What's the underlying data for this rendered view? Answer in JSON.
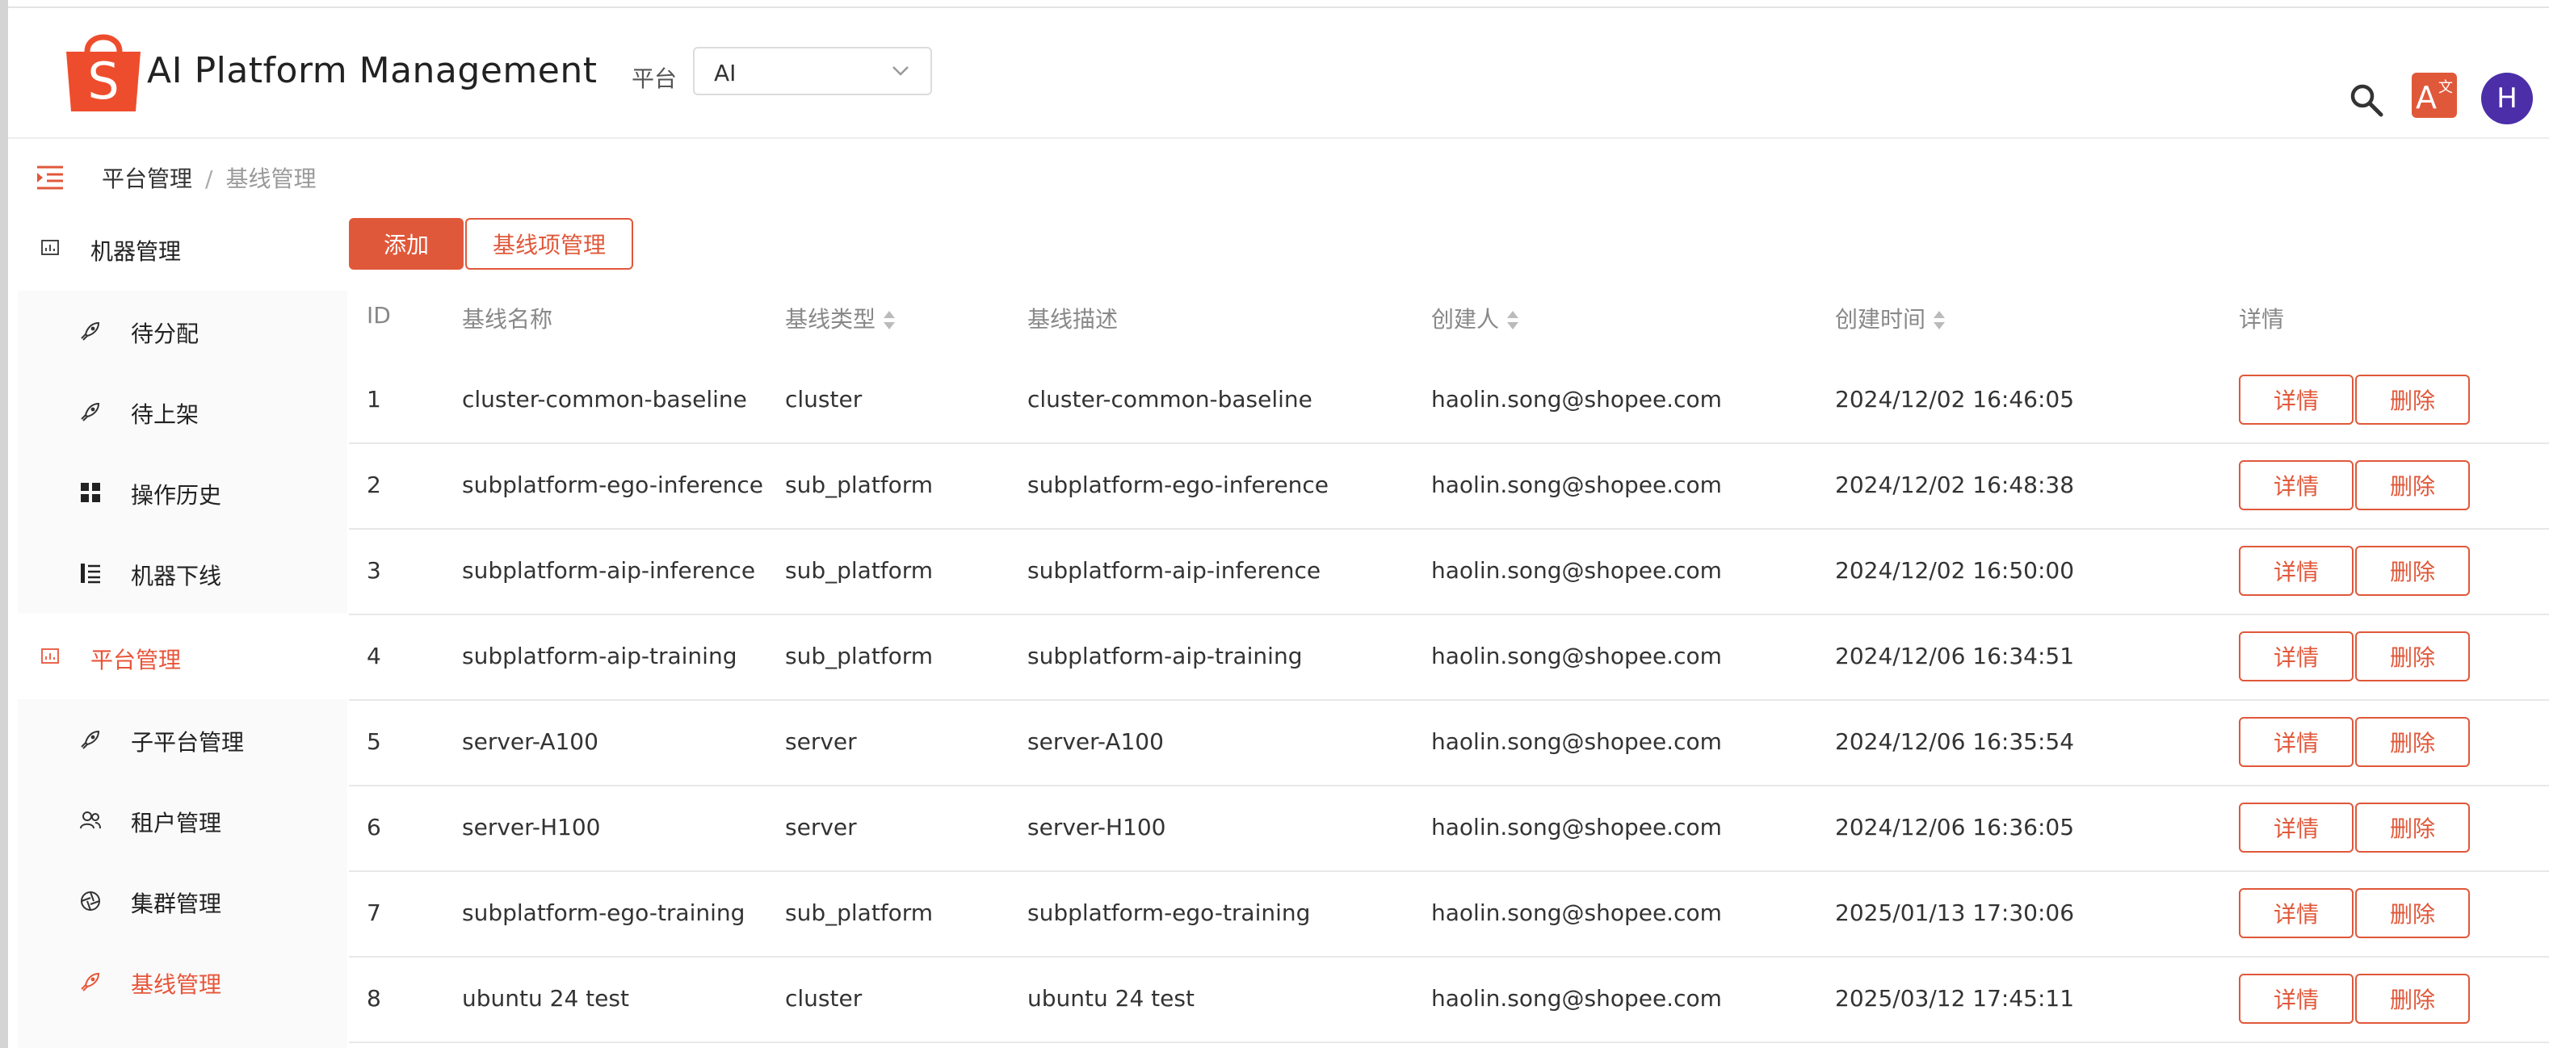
{
  "header": {
    "title": "AI Platform Management",
    "platform_label": "平台",
    "platform_value": "AI",
    "avatar_initial": "H"
  },
  "breadcrumb": {
    "items": [
      "平台管理",
      "基线管理"
    ],
    "separator": "/"
  },
  "sidebar": {
    "groups": [
      {
        "label": "机器管理",
        "items": [
          {
            "label": "待分配",
            "icon": "rocket-icon"
          },
          {
            "label": "待上架",
            "icon": "rocket-icon"
          },
          {
            "label": "操作历史",
            "icon": "grid-icon"
          },
          {
            "label": "机器下线",
            "icon": "list-icon"
          }
        ]
      },
      {
        "label": "平台管理",
        "items": [
          {
            "label": "子平台管理",
            "icon": "rocket-icon"
          },
          {
            "label": "租户管理",
            "icon": "users-icon"
          },
          {
            "label": "集群管理",
            "icon": "aperture-icon"
          },
          {
            "label": "基线管理",
            "icon": "rocket-icon"
          }
        ]
      }
    ]
  },
  "toolbar": {
    "add_label": "添加",
    "manage_label": "基线项管理"
  },
  "table": {
    "columns": [
      "ID",
      "基线名称",
      "基线类型",
      "基线描述",
      "创建人",
      "创建时间",
      "详情"
    ],
    "rows": [
      {
        "id": "1",
        "name": "cluster-common-baseline",
        "type": "cluster",
        "desc": "cluster-common-baseline",
        "creator": "haolin.song@shopee.com",
        "created": "2024/12/02 16:46:05"
      },
      {
        "id": "2",
        "name": "subplatform-ego-inference",
        "type": "sub_platform",
        "desc": "subplatform-ego-inference",
        "creator": "haolin.song@shopee.com",
        "created": "2024/12/02 16:48:38"
      },
      {
        "id": "3",
        "name": "subplatform-aip-inference",
        "type": "sub_platform",
        "desc": "subplatform-aip-inference",
        "creator": "haolin.song@shopee.com",
        "created": "2024/12/02 16:50:00"
      },
      {
        "id": "4",
        "name": "subplatform-aip-training",
        "type": "sub_platform",
        "desc": "subplatform-aip-training",
        "creator": "haolin.song@shopee.com",
        "created": "2024/12/06 16:34:51"
      },
      {
        "id": "5",
        "name": "server-A100",
        "type": "server",
        "desc": "server-A100",
        "creator": "haolin.song@shopee.com",
        "created": "2024/12/06 16:35:54"
      },
      {
        "id": "6",
        "name": "server-H100",
        "type": "server",
        "desc": "server-H100",
        "creator": "haolin.song@shopee.com",
        "created": "2024/12/06 16:36:05"
      },
      {
        "id": "7",
        "name": "subplatform-ego-training",
        "type": "sub_platform",
        "desc": "subplatform-ego-training",
        "creator": "haolin.song@shopee.com",
        "created": "2025/01/13 17:30:06"
      },
      {
        "id": "8",
        "name": "ubuntu 24 test",
        "type": "cluster",
        "desc": "ubuntu 24 test",
        "creator": "haolin.song@shopee.com",
        "created": "2025/03/12 17:45:11"
      }
    ],
    "detail_label": "详情",
    "delete_label": "删除"
  },
  "colors": {
    "brand": "#e0583a",
    "avatar": "#4b2ea8"
  }
}
